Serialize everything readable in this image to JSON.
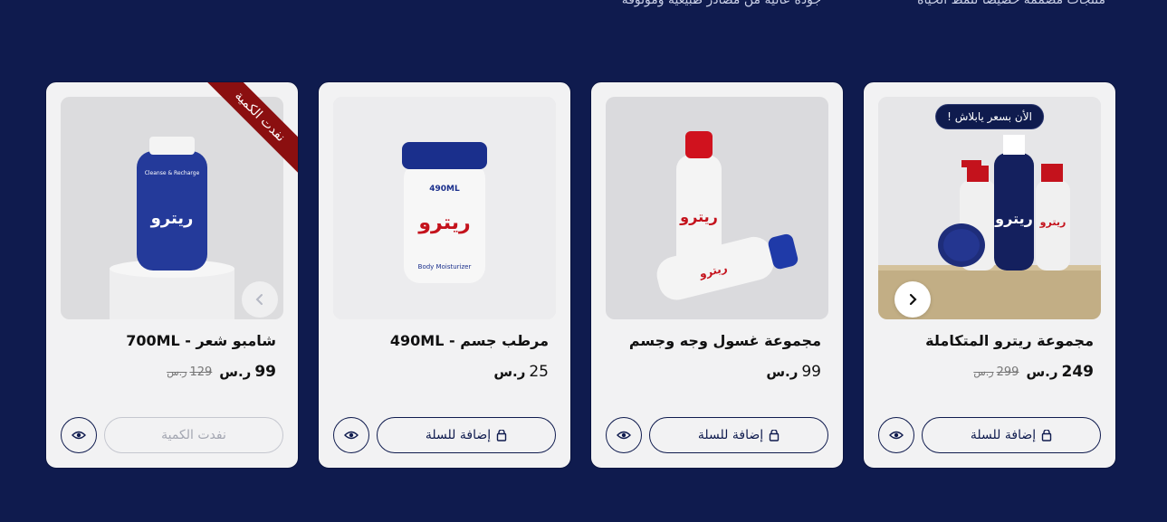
{
  "page": {
    "background": "#0f1b4e"
  },
  "top_strip": {
    "right_text": "منتجات مصممة خصيصا لنمط الحياة",
    "middle_text": "جودة عالية من مصادر طبيعية وموثوقة"
  },
  "currency_symbol": "ر.س",
  "colors": {
    "navy": "#0f1b4e",
    "ribbon": "#8b0f10",
    "card": "#f2f2f3"
  },
  "products": [
    {
      "name": "شامبو شعر - 700ML",
      "price": "99",
      "old_price": "129",
      "ribbon": "نفدت الكمية",
      "button_label": "نفدت الكمية",
      "button_disabled": true,
      "image_icon": "blue-bottle-image",
      "nav_icon": "chevron-left-icon"
    },
    {
      "name": "مرطب جسم - 490ML",
      "price": "25",
      "button_label": "إضافة للسلة",
      "image_icon": "white-jar-image"
    },
    {
      "name": "مجموعة غسول وجه وجسم",
      "price": "99",
      "button_label": "إضافة للسلة",
      "image_icon": "spray-bottles-image"
    },
    {
      "name": "مجموعة ريترو المتكاملة",
      "price": "249",
      "old_price": "299",
      "badge": "الأن بسعر يابلاش !",
      "button_label": "إضافة للسلة",
      "image_icon": "bundle-image",
      "nav_icon": "chevron-right-icon"
    }
  ]
}
